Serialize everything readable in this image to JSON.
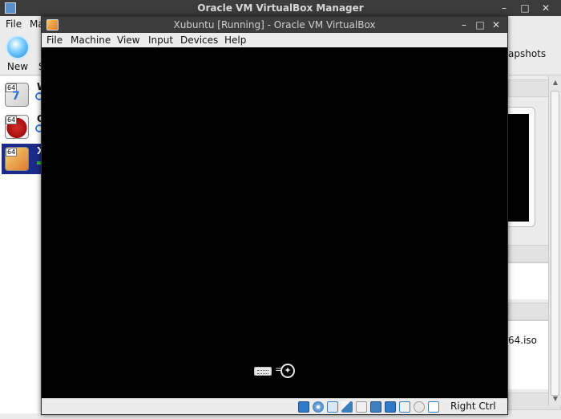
{
  "manager": {
    "title": "Oracle VM VirtualBox Manager",
    "menu": [
      "File",
      "Ma"
    ],
    "toolbar": {
      "new_label": "New",
      "partial_label": "S",
      "snapshots_label": "apshots"
    },
    "vms": [
      {
        "name": "W",
        "badge": "64",
        "icon": "windows7-vm-icon",
        "selected": false
      },
      {
        "name": "O",
        "badge": "64",
        "icon": "redhat-vm-icon",
        "selected": false
      },
      {
        "name": "X",
        "badge": "64",
        "icon": "xubuntu-vm-icon",
        "selected": true
      }
    ],
    "details_iso": "64.iso"
  },
  "vmwindow": {
    "title": "Xubuntu [Running] - Oracle VM VirtualBox",
    "menu": [
      "File",
      "Machine",
      "View",
      "Input",
      "Devices",
      "Help"
    ],
    "screen_eq": "=",
    "host_key": "Right Ctrl",
    "status_icons": [
      "hard-disk-icon",
      "optical-drive-icon",
      "audio-icon",
      "network-icon",
      "usb-icon",
      "shared-folders-icon",
      "display-icon",
      "video-capture-icon",
      "mouse-integration-icon",
      "host-key-arrow-icon"
    ]
  },
  "colors": {
    "titlebar": "#3c3c3c",
    "selection": "#1c2a8a",
    "screen": "#000000"
  }
}
